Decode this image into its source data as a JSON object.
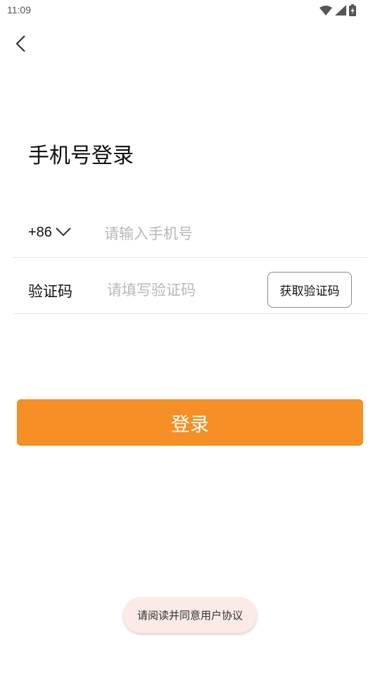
{
  "status_bar": {
    "time": "11:09",
    "icons": [
      "wifi-icon",
      "cellular-signal-icon",
      "battery-charging-icon"
    ]
  },
  "header": {
    "back_icon": "chevron-left-icon"
  },
  "page_title": "手机号登录",
  "phone_row": {
    "country_code": "+86",
    "dropdown_icon": "chevron-down-icon",
    "placeholder": "请输入手机号",
    "value": ""
  },
  "code_row": {
    "label": "验证码",
    "placeholder": "请填写验证码",
    "value": "",
    "get_code_label": "获取验证码"
  },
  "login_button": {
    "label": "登录"
  },
  "toast": {
    "message": "请阅读并同意用户协议"
  },
  "colors": {
    "accent": "#f68f25",
    "toast_bg": "#fbeae6",
    "placeholder": "#b8b8b8",
    "divider": "#e4e4e4"
  }
}
